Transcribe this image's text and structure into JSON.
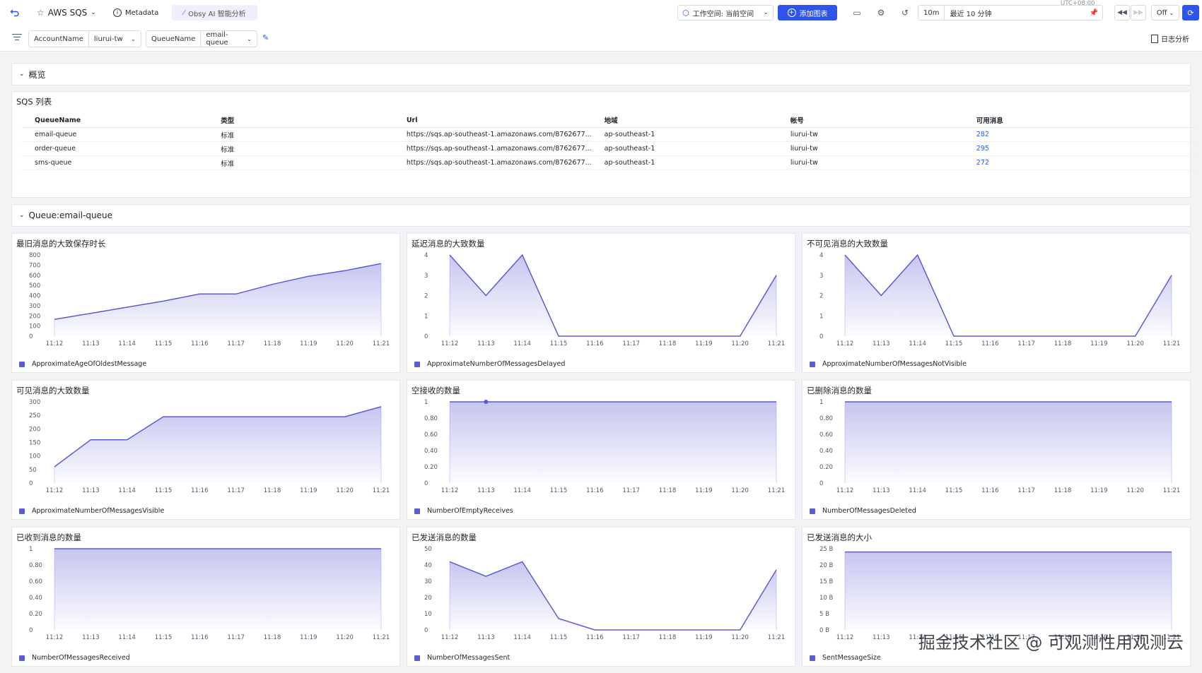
{
  "topbar": {
    "dashboard_title": "AWS SQS",
    "metadata_label": "Metadata",
    "ai_label": "Obsy AI 智能分析",
    "workspace_label": "工作空间: 当前空间",
    "add_chart_label": "添加图表",
    "time_short": "10m",
    "time_range": "最近 10 分钟",
    "timezone": "UTC+08:00",
    "refresh_label": "Off"
  },
  "filters": {
    "account_key": "AccountName",
    "account_value": "liurui-tw",
    "queue_key": "QueueName",
    "queue_value": "email-queue",
    "log_analysis_label": "日志分析"
  },
  "sections": {
    "overview": "概览",
    "queue": "Queue:email-queue"
  },
  "sqs_table": {
    "title": "SQS 列表",
    "columns": [
      "QueueName",
      "类型",
      "Url",
      "地域",
      "帐号",
      "可用消息"
    ],
    "rows": [
      [
        "email-queue",
        "标准",
        "https://sqs.ap-southeast-1.amazonaws.com/8762677...",
        "ap-southeast-1",
        "liurui-tw",
        "282"
      ],
      [
        "order-queue",
        "标准",
        "https://sqs.ap-southeast-1.amazonaws.com/8762677...",
        "ap-southeast-1",
        "liurui-tw",
        "295"
      ],
      [
        "sms-queue",
        "标准",
        "https://sqs.ap-southeast-1.amazonaws.com/8762677...",
        "ap-southeast-1",
        "liurui-tw",
        "272"
      ]
    ]
  },
  "colors": {
    "accent": "#2f54eb",
    "series": "#5b5bd6"
  },
  "watermark": "掘金技术社区 @ 可观测性用观测云",
  "chart_data": [
    {
      "type": "area",
      "title": "最旧消息的大致保存时长",
      "x": [
        "11:12",
        "11:13",
        "11:14",
        "11:15",
        "11:16",
        "11:17",
        "11:18",
        "11:19",
        "11:20",
        "11:21"
      ],
      "series": [
        {
          "name": "ApproximateAgeOfOldestMessage",
          "values": [
            165,
            225,
            285,
            345,
            415,
            415,
            510,
            590,
            645,
            715
          ]
        }
      ],
      "yticks": [
        "0",
        "100",
        "200",
        "300",
        "400",
        "500",
        "600",
        "700",
        "800"
      ],
      "ylim": [
        0,
        800
      ]
    },
    {
      "type": "area",
      "title": "延迟消息的大致数量",
      "x": [
        "11:12",
        "11:13",
        "11:14",
        "11:15",
        "11:16",
        "11:17",
        "11:18",
        "11:19",
        "11:20",
        "11:21"
      ],
      "series": [
        {
          "name": "ApproximateNumberOfMessagesDelayed",
          "values": [
            4,
            2,
            4,
            0,
            0,
            0,
            0,
            0,
            0,
            3
          ]
        }
      ],
      "yticks": [
        "0",
        "1",
        "2",
        "3",
        "4"
      ],
      "ylim": [
        0,
        4
      ]
    },
    {
      "type": "area",
      "title": "不可见消息的大致数量",
      "x": [
        "11:12",
        "11:13",
        "11:14",
        "11:15",
        "11:16",
        "11:17",
        "11:18",
        "11:19",
        "11:20",
        "11:21"
      ],
      "series": [
        {
          "name": "ApproximateNumberOfMessagesNotVisible",
          "values": [
            4,
            2,
            4,
            0,
            0,
            0,
            0,
            0,
            0,
            3
          ]
        }
      ],
      "yticks": [
        "0",
        "1",
        "2",
        "3",
        "4"
      ],
      "ylim": [
        0,
        4
      ]
    },
    {
      "type": "area",
      "title": "可见消息的大致数量",
      "x": [
        "11:12",
        "11:13",
        "11:14",
        "11:15",
        "11:16",
        "11:17",
        "11:18",
        "11:19",
        "11:20",
        "11:21"
      ],
      "series": [
        {
          "name": "ApproximateNumberOfMessagesVisible",
          "values": [
            60,
            160,
            160,
            245,
            245,
            245,
            245,
            245,
            245,
            282
          ]
        }
      ],
      "yticks": [
        "0",
        "50",
        "100",
        "150",
        "200",
        "250",
        "300"
      ],
      "ylim": [
        0,
        300
      ]
    },
    {
      "type": "area",
      "title": "空接收的数量",
      "x": [
        "11:12",
        "11:13",
        "11:14",
        "11:15",
        "11:16",
        "11:17",
        "11:18",
        "11:19",
        "11:20",
        "11:21"
      ],
      "series": [
        {
          "name": "NumberOfEmptyReceives",
          "values": [
            1,
            1,
            1,
            1,
            1,
            1,
            1,
            1,
            1,
            1
          ]
        }
      ],
      "yticks": [
        "0",
        "0.20",
        "0.40",
        "0.60",
        "0.80",
        "1"
      ],
      "ylim": [
        0,
        1
      ],
      "marker_index": 1
    },
    {
      "type": "area",
      "title": "已删除消息的数量",
      "x": [
        "11:12",
        "11:13",
        "11:14",
        "11:15",
        "11:16",
        "11:17",
        "11:18",
        "11:19",
        "11:20",
        "11:21"
      ],
      "series": [
        {
          "name": "NumberOfMessagesDeleted",
          "values": [
            1,
            1,
            1,
            1,
            1,
            1,
            1,
            1,
            1,
            1
          ]
        }
      ],
      "yticks": [
        "0",
        "0.20",
        "0.40",
        "0.60",
        "0.80",
        "1"
      ],
      "ylim": [
        0,
        1
      ]
    },
    {
      "type": "area",
      "title": "已收到消息的数量",
      "x": [
        "11:12",
        "11:13",
        "11:14",
        "11:15",
        "11:16",
        "11:17",
        "11:18",
        "11:19",
        "11:20",
        "11:21"
      ],
      "series": [
        {
          "name": "NumberOfMessagesReceived",
          "values": [
            1,
            1,
            1,
            1,
            1,
            1,
            1,
            1,
            1,
            1
          ]
        }
      ],
      "yticks": [
        "0",
        "0.20",
        "0.40",
        "0.60",
        "0.80",
        "1"
      ],
      "ylim": [
        0,
        1
      ]
    },
    {
      "type": "area",
      "title": "已发送消息的数量",
      "x": [
        "11:12",
        "11:13",
        "11:14",
        "11:15",
        "11:16",
        "11:17",
        "11:18",
        "11:19",
        "11:20",
        "11:21"
      ],
      "series": [
        {
          "name": "NumberOfMessagesSent",
          "values": [
            42,
            33,
            42,
            7,
            0,
            0,
            0,
            0,
            0,
            37
          ]
        }
      ],
      "yticks": [
        "0",
        "10",
        "20",
        "30",
        "40",
        "50"
      ],
      "ylim": [
        0,
        50
      ]
    },
    {
      "type": "area",
      "title": "已发送消息的大小",
      "x": [
        "11:12",
        "11:13",
        "11:14",
        "11:15",
        "11:16",
        "11:17",
        "11:18",
        "11:19",
        "11:20",
        "11:21"
      ],
      "series": [
        {
          "name": "SentMessageSize",
          "values": [
            24,
            24,
            24,
            24,
            24,
            24,
            24,
            24,
            24,
            24
          ]
        }
      ],
      "yticks": [
        "0 B",
        "5 B",
        "10 B",
        "15 B",
        "20 B",
        "25 B"
      ],
      "ylim": [
        0,
        25
      ]
    }
  ]
}
